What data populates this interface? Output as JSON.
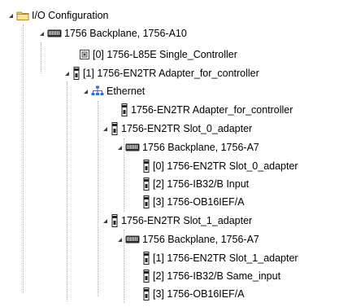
{
  "tree": {
    "root": {
      "label": "I/O Configuration",
      "icon": "folder-icon"
    },
    "backplane_main": {
      "label": "1756 Backplane, 1756-A10",
      "icon": "backplane-icon"
    },
    "controller": {
      "label": "[0] 1756-L85E Single_Controller",
      "icon": "controller-icon"
    },
    "adapter_main": {
      "label": "[1] 1756-EN2TR Adapter_for_controller",
      "icon": "module-icon"
    },
    "ethernet": {
      "label": "Ethernet",
      "icon": "network-icon"
    },
    "eth_adapter": {
      "label": "1756-EN2TR Adapter_for_controller",
      "icon": "module-icon"
    },
    "slot0": {
      "label": "1756-EN2TR Slot_0_adapter",
      "backplane": "1756 Backplane, 1756-A7",
      "modules": [
        "[0] 1756-EN2TR Slot_0_adapter",
        "[2] 1756-IB32/B Input",
        "[3] 1756-OB16IEF/A"
      ]
    },
    "slot1": {
      "label": "1756-EN2TR Slot_1_adapter",
      "backplane": "1756 Backplane, 1756-A7",
      "modules": [
        "[1] 1756-EN2TR Slot_1_adapter",
        "[2] 1756-IB32/B Same_input",
        "[3] 1756-OB16IEF/A"
      ]
    }
  }
}
